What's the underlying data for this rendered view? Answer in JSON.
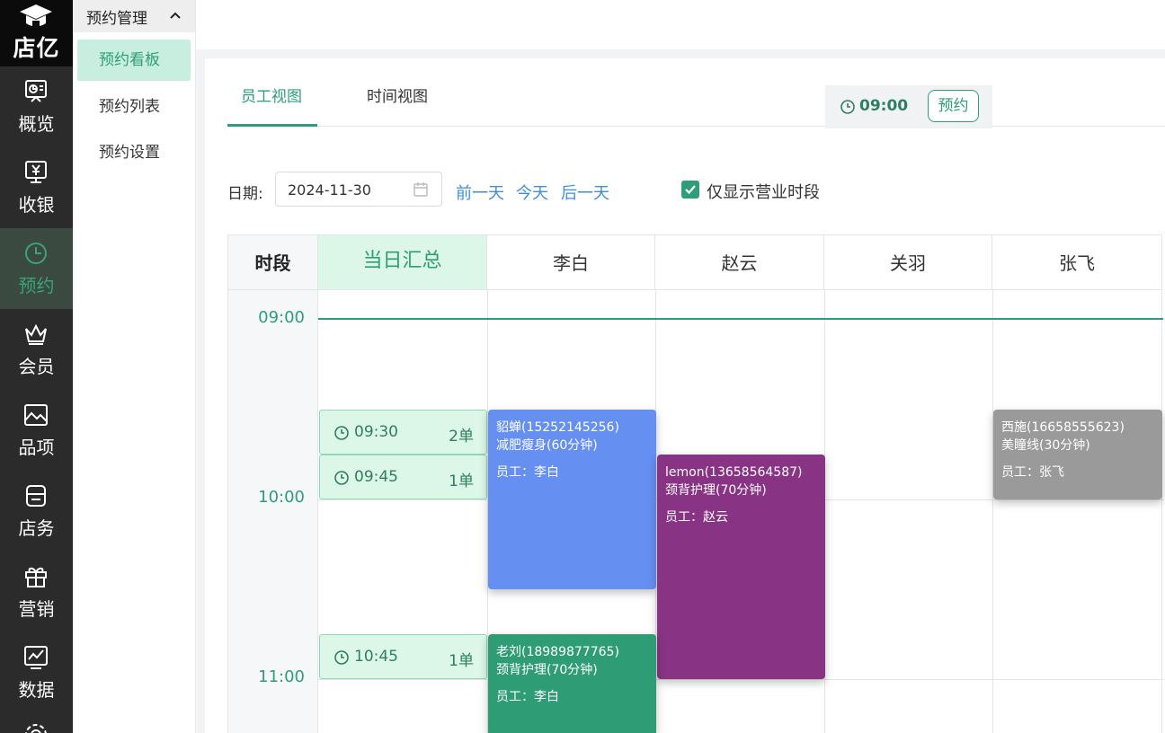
{
  "brand": {
    "name": "店亿"
  },
  "nav": [
    {
      "label": "概览",
      "icon": "dashboard-icon"
    },
    {
      "label": "收银",
      "icon": "cashier-icon"
    },
    {
      "label": "预约",
      "icon": "clock-icon"
    },
    {
      "label": "会员",
      "icon": "crown-icon"
    },
    {
      "label": "品项",
      "icon": "image-icon"
    },
    {
      "label": "店务",
      "icon": "store-icon"
    },
    {
      "label": "营销",
      "icon": "gift-icon"
    },
    {
      "label": "数据",
      "icon": "chart-icon"
    }
  ],
  "submenu": {
    "title": "预约管理",
    "items": [
      "预约看板",
      "预约列表",
      "预约设置"
    ]
  },
  "tabs": [
    "员工视图",
    "时间视图"
  ],
  "filter": {
    "date_label": "日期:",
    "date_value": "2024-11-30",
    "prev": "前一天",
    "today": "今天",
    "next": "后一天",
    "only_business_hours": "仅显示营业时段"
  },
  "grid": {
    "time_header": "时段",
    "summary_header": "当日汇总",
    "staff": [
      "李白",
      "赵云",
      "关羽",
      "张飞"
    ],
    "times": [
      "09:00",
      "10:00",
      "11:00"
    ]
  },
  "open_slot": {
    "time": "09:00",
    "button": "预约"
  },
  "summaries": [
    {
      "time": "09:30",
      "count": "2单"
    },
    {
      "time": "09:45",
      "count": "1单"
    },
    {
      "time": "10:45",
      "count": "1单"
    }
  ],
  "appointments": [
    {
      "customer": "貂蝉(15252145256)",
      "service": "减肥瘦身(60分钟)",
      "staff": "员工：李白",
      "color": "#658ff0"
    },
    {
      "customer": "lemon(13658564587)",
      "service": "颈背护理(70分钟)",
      "staff": "员工：赵云",
      "color": "#883384"
    },
    {
      "customer": "西施(16658555623)",
      "service": "美瞳线(30分钟)",
      "staff": "员工：张飞",
      "color": "#9a9a9a"
    },
    {
      "customer": "老刘(18989877765)",
      "service": "颈背护理(70分钟)",
      "staff": "员工：李白",
      "color": "#2e9c74"
    }
  ],
  "colors": {
    "accent": "#2e9e78",
    "link": "#3f8fd8",
    "rail": "#2b2b2b"
  }
}
